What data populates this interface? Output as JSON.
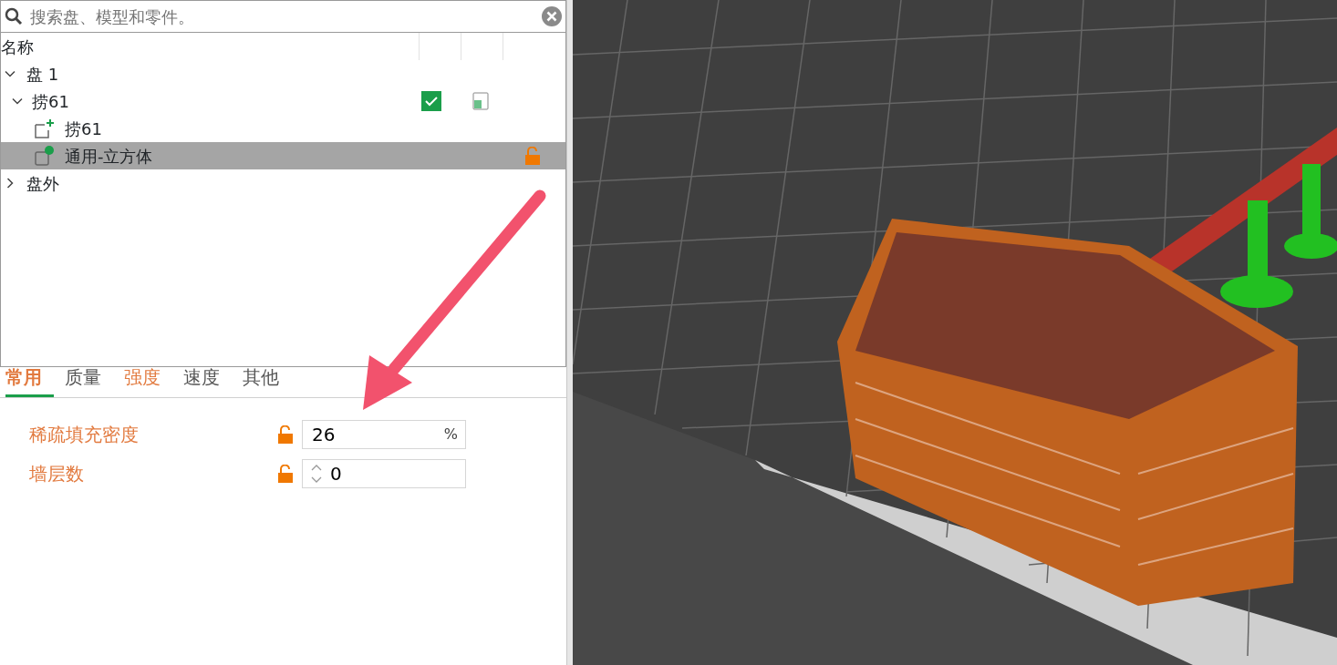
{
  "search": {
    "placeholder": "搜索盘、模型和零件。"
  },
  "tree": {
    "header": "名称",
    "items": [
      {
        "label": "盘 1",
        "expanded": true,
        "children": [
          {
            "label": "捞61",
            "expanded": true,
            "checked": true,
            "children": [
              {
                "label": "捞61",
                "kind": "part",
                "selected": false
              },
              {
                "label": "通用-立方体",
                "kind": "modifier",
                "selected": true
              }
            ]
          }
        ]
      },
      {
        "label": "盘外",
        "expanded": false
      }
    ]
  },
  "tabs": [
    {
      "label": "常用",
      "selected": true,
      "modified": true
    },
    {
      "label": "质量",
      "selected": false,
      "modified": false
    },
    {
      "label": "强度",
      "selected": false,
      "modified": true
    },
    {
      "label": "速度",
      "selected": false,
      "modified": false
    },
    {
      "label": "其他",
      "selected": false,
      "modified": false
    }
  ],
  "settings": [
    {
      "label": "稀疏填充密度",
      "kind": "percent",
      "value": "26",
      "unit": "%"
    },
    {
      "label": "墙层数",
      "kind": "spin",
      "value": "0"
    }
  ]
}
